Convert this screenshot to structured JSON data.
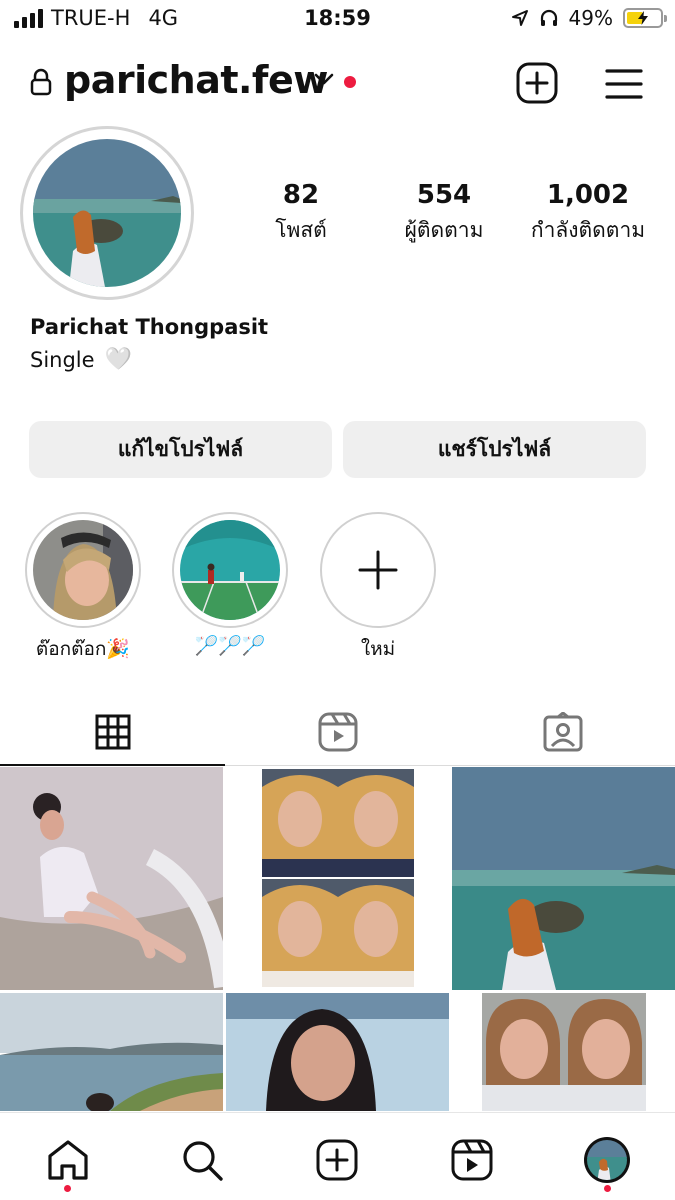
{
  "status_bar": {
    "carrier": "TRUE-H",
    "network": "4G",
    "time": "18:59",
    "battery": "49%",
    "icons": [
      "signal-icon",
      "location-arrow-icon",
      "headphones-icon",
      "battery-charging-icon"
    ],
    "battery_level": 0.49
  },
  "header": {
    "username": "parichat.few",
    "icons": [
      "lock-icon",
      "chevron-down-icon",
      "new-post-icon",
      "menu-icon"
    ]
  },
  "profile": {
    "stats": [
      {
        "value": "82",
        "label": "โพสต์"
      },
      {
        "value": "554",
        "label": "ผู้ติดตาม"
      },
      {
        "value": "1,002",
        "label": "กำลังติดตาม"
      }
    ],
    "full_name": "Parichat Thongpasit",
    "bio": "Single",
    "bio_emoji": "🤍"
  },
  "buttons": {
    "edit_profile": "แก้ไขโปรไฟล์",
    "share_profile": "แชร์โปรไฟล์"
  },
  "highlights": [
    {
      "label": "ต๊อกต๊อก🎉"
    },
    {
      "label": "🏸🏸🏸"
    },
    {
      "label": "ใหม่"
    }
  ],
  "tabs": [
    "grid-icon",
    "reels-icon",
    "tagged-icon"
  ],
  "bottom_nav": [
    "home-icon",
    "search-icon",
    "create-icon",
    "reels-icon",
    "profile-avatar"
  ],
  "colors": {
    "accent_red": "#ed1c40",
    "button_bg": "#efefef",
    "battery_yellow": "#f5d20b"
  }
}
